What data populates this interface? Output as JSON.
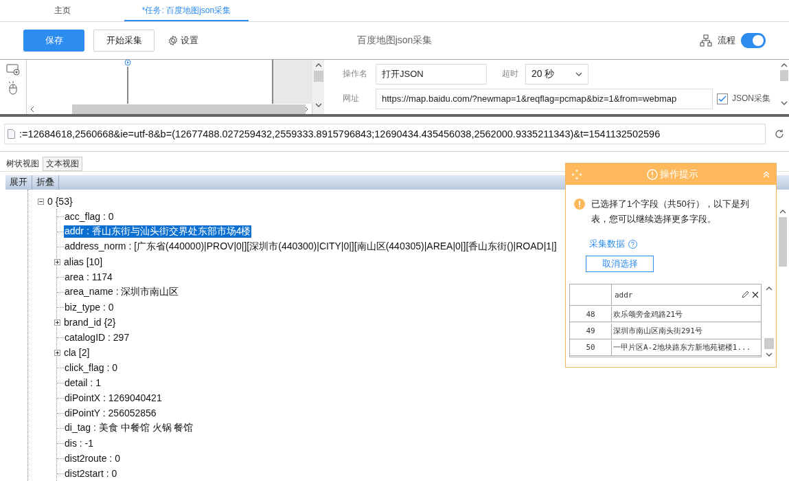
{
  "tabs": [
    {
      "label": "主页",
      "selected": false
    },
    {
      "label": "*任务: 百度地图json采集",
      "selected": true
    }
  ],
  "toolbar": {
    "save": "保存",
    "start": "开始采集",
    "settings": "设置",
    "task_title": "百度地图json采集",
    "flow_label": "流程",
    "flow_on": true
  },
  "step": {
    "name_label": "操作名",
    "name_value": "打开JSON",
    "timeout_label": "超时",
    "timeout_value": "20 秒",
    "url_label": "网址",
    "url_value": "https://map.baidu.com/?newmap=1&reqflag=pcmap&biz=1&from=webmap",
    "json_label": "JSON采集",
    "json_checked": true
  },
  "address_bar": ":=12684618,2560668&ie=utf-8&b=(12677488.027259432,2559333.8915796843;12690434.435456038,2562000.9335211343)&t=1541132502596",
  "view_tabs": [
    {
      "label": "树状视图",
      "selected": true
    },
    {
      "label": "文本视图",
      "selected": false
    }
  ],
  "tree_actions": [
    "展开",
    "折叠"
  ],
  "tree": [
    {
      "label": "0 {53}",
      "kind": "branch",
      "expanded": true,
      "selected": false,
      "children": [
        {
          "label": "acc_flag : 0",
          "kind": "leaf",
          "selected": false
        },
        {
          "label": "addr : 香山东街与汕头街交界处东部市场4楼",
          "kind": "leaf",
          "selected": true
        },
        {
          "label": "address_norm : [广东省(440000)|PROV|0|][深圳市(440300)|CITY|0|][南山区(440305)|AREA|0|][香山东街()|ROAD|1|]",
          "kind": "leaf",
          "selected": false
        },
        {
          "label": "alias [10]",
          "kind": "branch",
          "expanded": false,
          "selected": false
        },
        {
          "label": "area : 1174",
          "kind": "leaf",
          "selected": false
        },
        {
          "label": "area_name : 深圳市南山区",
          "kind": "leaf",
          "selected": false
        },
        {
          "label": "biz_type : 0",
          "kind": "leaf",
          "selected": false
        },
        {
          "label": "brand_id {2}",
          "kind": "branch",
          "expanded": false,
          "selected": false
        },
        {
          "label": "catalogID : 297",
          "kind": "leaf",
          "selected": false
        },
        {
          "label": "cla [2]",
          "kind": "branch",
          "expanded": false,
          "selected": false
        },
        {
          "label": "click_flag : 0",
          "kind": "leaf",
          "selected": false
        },
        {
          "label": "detail : 1",
          "kind": "leaf",
          "selected": false
        },
        {
          "label": "diPointX : 1269040421",
          "kind": "leaf",
          "selected": false
        },
        {
          "label": "diPointY : 256052856",
          "kind": "leaf",
          "selected": false
        },
        {
          "label": "di_tag : 美食 中餐馆 火锅 餐馆",
          "kind": "leaf",
          "selected": false
        },
        {
          "label": "dis : -1",
          "kind": "leaf",
          "selected": false
        },
        {
          "label": "dist2route : 0",
          "kind": "leaf",
          "selected": false
        },
        {
          "label": "dist2start : 0",
          "kind": "leaf",
          "selected": false
        }
      ]
    }
  ],
  "tip": {
    "title": "操作提示",
    "message": "已选择了1个字段（共50行），以下是列表，您可以继续选择更多字段。",
    "link": "采集数据",
    "cancel": "取消选择",
    "column": "addr",
    "rows": [
      {
        "index": "48",
        "value": "欢乐颂旁金鸡路21号"
      },
      {
        "index": "49",
        "value": "深圳市南山区南头街291号"
      },
      {
        "index": "50",
        "value": "一甲片区A-2地块路东方新地苑裙楼1..."
      }
    ]
  }
}
